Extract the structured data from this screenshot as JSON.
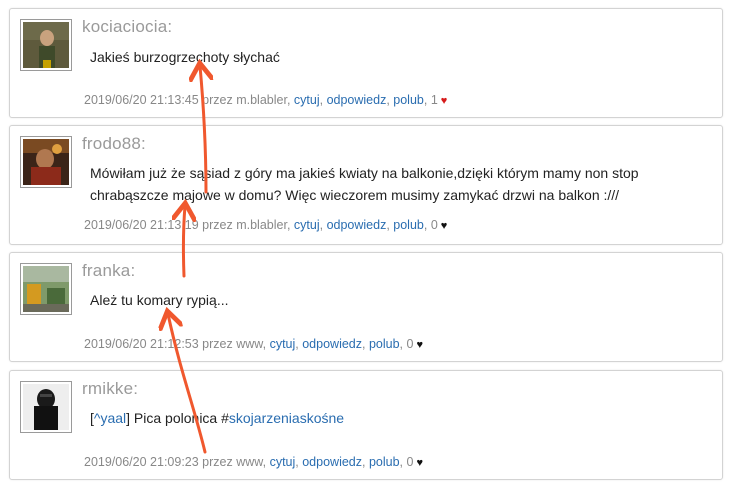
{
  "posts": [
    {
      "username": "kociaciocia:",
      "message": "Jakieś burzogrzechoty słychać",
      "timestamp": "2019/06/20 21:13:45",
      "by_prefix": " przez ",
      "by_user": "m.blabler",
      "cite": "cytuj",
      "reply": "odpowiedz",
      "like": "polub",
      "likes": "1",
      "heart_color": "#d61a1a"
    },
    {
      "username": "frodo88:",
      "message": "Mówiłam już że sąsiad z góry ma jakieś kwiaty na balkonie,dzięki którym mamy non stop chrabąszcze majowe w domu? Więc wieczorem musimy zamykać drzwi na balkon :///",
      "timestamp": "2019/06/20 21:13:19",
      "by_prefix": " przez ",
      "by_user": "m.blabler",
      "cite": "cytuj",
      "reply": "odpowiedz",
      "like": "polub",
      "likes": "0",
      "heart_color": "#111111"
    },
    {
      "username": "franka:",
      "message": "Ależ tu komary rypią...",
      "timestamp": "2019/06/20 21:12:53",
      "by_prefix": " przez ",
      "by_user": "www",
      "cite": "cytuj",
      "reply": "odpowiedz",
      "like": "polub",
      "likes": "0",
      "heart_color": "#111111"
    },
    {
      "username": "rmikke:",
      "reply_open": "[",
      "reply_ref": "^yaal",
      "reply_close": "]",
      "message_text": " Pica polonica #",
      "hashtag": "skojarzeniaskośne",
      "timestamp": "2019/06/20 21:09:23",
      "by_prefix": " przez ",
      "by_user": "www",
      "cite": "cytuj",
      "reply": "odpowiedz",
      "like": "polub",
      "likes": "0",
      "heart_color": "#111111"
    }
  ],
  "separator": ", ",
  "heart_glyph": "♥",
  "colors": {
    "link": "#2a6db0",
    "annotation_arrow": "#f0582e"
  }
}
